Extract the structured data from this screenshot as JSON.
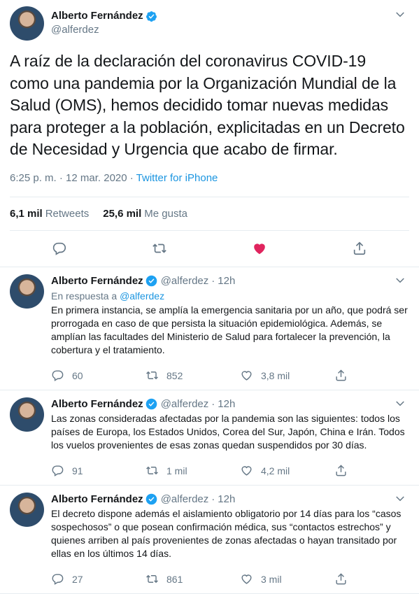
{
  "main": {
    "author_name": "Alberto Fernández",
    "author_handle": "@alferdez",
    "text": "A raíz de la declaración del coronavirus COVID-19 como una pandemia por la Organización Mundial de la Salud (OMS), hemos decidido tomar nuevas medidas para proteger a la población, explicitadas en un Decreto de Necesidad y Urgencia que acabo de firmar.",
    "time": "6:25 p. m. · 12 mar. 2020 · ",
    "source": "Twitter for iPhone",
    "retweets_count": "6,1 mil",
    "retweets_label": "Retweets",
    "likes_count": "25,6 mil",
    "likes_label": "Me gusta"
  },
  "replies": [
    {
      "author_name": "Alberto Fernández",
      "author_handle": "@alferdez",
      "time": "12h",
      "in_reply_prefix": "En respuesta a ",
      "in_reply_handle": "@alferdez",
      "text": "En primera instancia, se amplía la emergencia sanitaria por un año, que podrá ser prorrogada en caso de que persista la situación epidemiológica. Además, se amplían las facultades del Ministerio de Salud para fortalecer la prevención, la cobertura y el tratamiento.",
      "replies": "60",
      "retweets": "852",
      "likes": "3,8 mil"
    },
    {
      "author_name": "Alberto Fernández",
      "author_handle": "@alferdez",
      "time": "12h",
      "text": "Las zonas consideradas afectadas por la pandemia son las siguientes: todos los países de Europa, los Estados Unidos, Corea del Sur, Japón, China e Irán. Todos los vuelos provenientes de esas zonas quedan suspendidos por 30 días.",
      "replies": "91",
      "retweets": "1 mil",
      "likes": "4,2 mil"
    },
    {
      "author_name": "Alberto Fernández",
      "author_handle": "@alferdez",
      "time": "12h",
      "text": "El decreto dispone además el aislamiento obligatorio por 14 días para los “casos sospechosos” o que posean confirmación médica, sus “contactos estrechos” y quienes arriben al país provenientes de zonas afectadas o hayan transitado por ellas en los últimos 14 días.",
      "replies": "27",
      "retweets": "861",
      "likes": "3 mil"
    }
  ],
  "colors": {
    "accent": "#1b95e0",
    "like": "#e0245e",
    "muted": "#657786",
    "verified": "#1da1f2"
  }
}
